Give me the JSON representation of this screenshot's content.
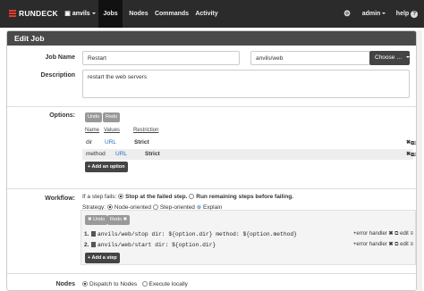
{
  "navbar": {
    "brand": "RUNDECK",
    "project": "anvils",
    "items": [
      "Jobs",
      "Nodes",
      "Commands",
      "Activity"
    ],
    "gear": "⚙",
    "user": "admin",
    "help": "help"
  },
  "panel": {
    "title": "Edit Job"
  },
  "job": {
    "name_label": "Job Name",
    "name_value": "Restart",
    "group_value": "anvils/web",
    "choose_label": "Choose …",
    "description_label": "Description",
    "description_value": "restart the web servers"
  },
  "options": {
    "label": "Options:",
    "undo": "Undo",
    "redo": "Redo",
    "headers": [
      "Name",
      "Values",
      "Restriction"
    ],
    "rows": [
      {
        "name": "dir",
        "values": "URL",
        "restriction": "Strict",
        "edit": "edit"
      },
      {
        "name": "method",
        "values": "URL",
        "restriction": "Strict",
        "edit": "edit"
      }
    ],
    "add_label": "+ Add an option"
  },
  "workflow": {
    "label": "Workflow:",
    "fail_text": "If a step fails:",
    "fail_opt1": "Stop at the failed step.",
    "fail_opt2": "Run remaining steps before failing.",
    "strategy_text": "Strategy:",
    "strat_opt1": "Node-oriented",
    "strat_opt2": "Step-oriented",
    "explain": "Explain",
    "undo": "Undo",
    "redo": "Redo",
    "steps": [
      {
        "num": "1.",
        "code": "anvils/web/stop dir: ${option.dir} method: ${option.method}"
      },
      {
        "num": "2.",
        "code": "anvils/web/start dir: ${option.dir}"
      }
    ],
    "error_handler": "+error handler",
    "edit": "edit",
    "add_step": "+ Add a step"
  },
  "nodes": {
    "label": "Nodes",
    "opt1": "Dispatch to Nodes",
    "opt2": "Execute locally"
  },
  "colors": {
    "navbar": "#2b2b2b",
    "panel_header": "#4a4a4a",
    "link": "#2a6ebd",
    "brand_red": "#e33a2b"
  }
}
